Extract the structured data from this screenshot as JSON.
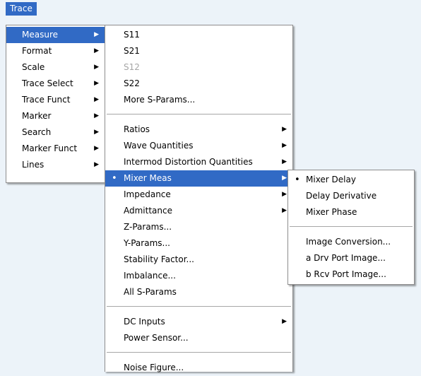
{
  "menubar": {
    "trace": "Trace"
  },
  "arrow_glyph": "▶",
  "bullet_glyph": "•",
  "main_menu": [
    "Measure",
    "Format",
    "Scale",
    "Trace Select",
    "Trace Funct",
    "Marker",
    "Search",
    "Marker Funct",
    "Lines"
  ],
  "measure_menu": {
    "group1": [
      "S11",
      "S21",
      "S12",
      "S22",
      "More S-Params..."
    ],
    "disabled_item": "S12",
    "group2": [
      "Ratios",
      "Wave Quantities",
      "Intermod Distortion Quantities",
      "Mixer Meas",
      "Impedance",
      "Admittance",
      "Z-Params...",
      "Y-Params...",
      "Stability Factor...",
      "Imbalance...",
      "All S-Params"
    ],
    "group3": [
      "DC Inputs",
      "Power Sensor..."
    ],
    "group4": [
      "Noise Figure..."
    ]
  },
  "mixer_menu": {
    "group1": [
      "Mixer Delay",
      "Delay Derivative",
      "Mixer Phase"
    ],
    "group2": [
      "Image Conversion...",
      "a Drv Port Image...",
      "b Rcv Port Image..."
    ]
  },
  "colors": {
    "highlight": "#316ac5",
    "background": "#ecf3f9",
    "disabled_text": "#a6a6a6"
  }
}
